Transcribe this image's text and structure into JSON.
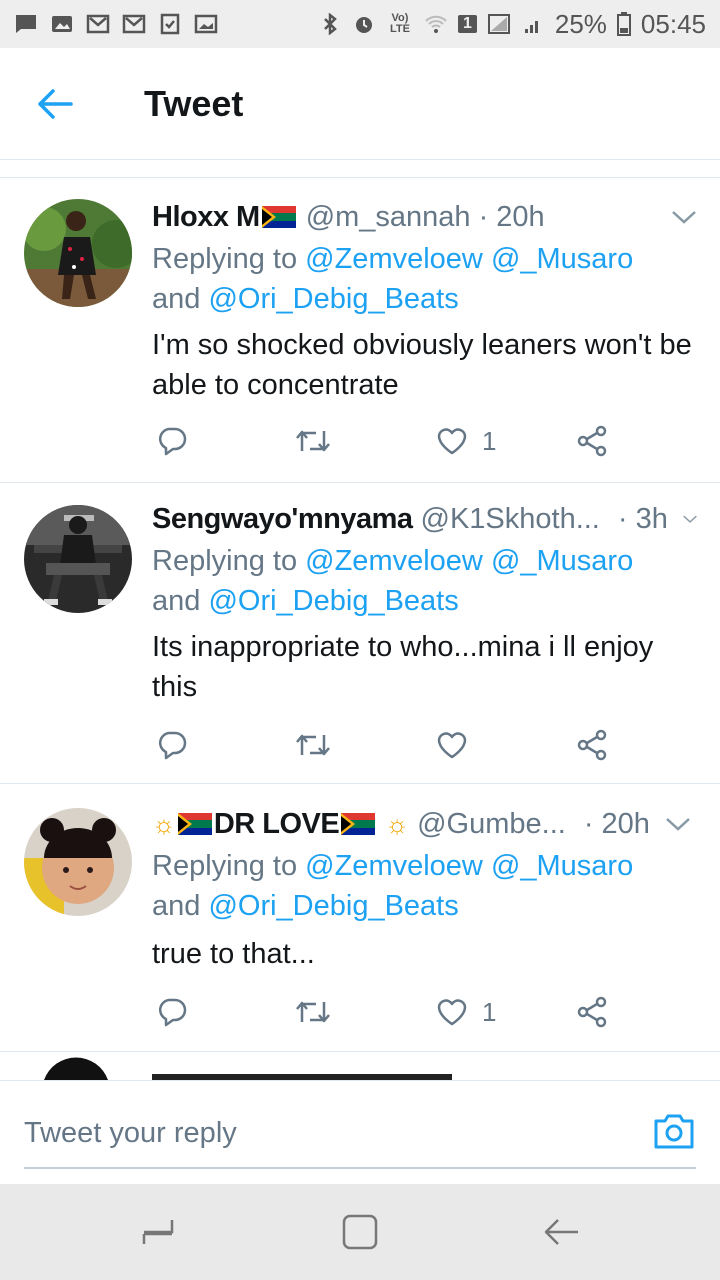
{
  "status_bar": {
    "battery": "25%",
    "time": "05:45",
    "sim_badge": "1",
    "volte": "Vo) LTE"
  },
  "header": {
    "title": "Tweet"
  },
  "tweets": [
    {
      "name": "Hloxx M",
      "handle": "@m_sannah",
      "time": "· 20h",
      "replying_prefix": "Replying to",
      "mention1": "@Zemveloew",
      "mention2": "@_Musaro",
      "and": "and",
      "mention3": "@Ori_Debig_Beats",
      "text": "I'm so shocked obviously leaners won't be able to concentrate",
      "likes": "1"
    },
    {
      "name": "Sengwayo'mnyama",
      "handle": "@K1Skhoth...",
      "time": "· 3h",
      "replying_prefix": "Replying to",
      "mention1": "@Zemveloew",
      "mention2": "@_Musaro",
      "and": "and",
      "mention3": "@Ori_Debig_Beats",
      "text": "Its inappropriate to who...mina i ll enjoy this",
      "likes": ""
    },
    {
      "name": "DR LOVE",
      "handle": "@Gumbe...",
      "time": "· 20h",
      "replying_prefix": "Replying to",
      "mention1": "@Zemveloew",
      "mention2": "@_Musaro",
      "and": "and",
      "mention3": "@Ori_Debig_Beats",
      "text": "true to that...",
      "likes": "1"
    }
  ],
  "reply_bar": {
    "placeholder": "Tweet your reply"
  },
  "colors": {
    "accent": "#1da1f2",
    "secondary_text": "#657786",
    "divider": "#e1e8ed"
  },
  "icons": {
    "back": "arrow-left-icon",
    "chevron": "chevron-down-icon",
    "reply": "reply-icon",
    "retweet": "retweet-icon",
    "like": "heart-icon",
    "share": "share-icon",
    "camera": "camera-icon"
  }
}
